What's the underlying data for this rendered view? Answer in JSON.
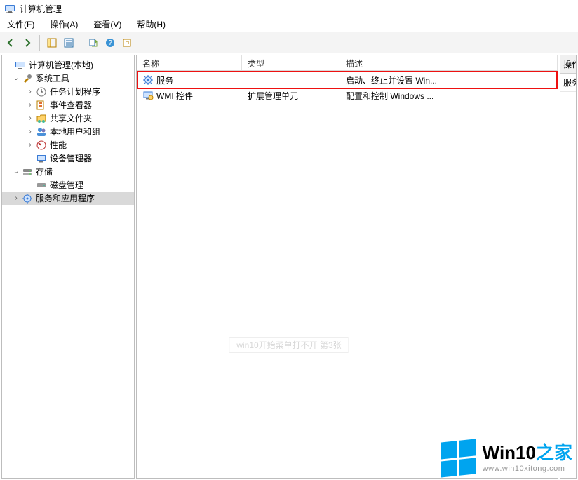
{
  "title": "计算机管理",
  "menus": {
    "file": "文件(F)",
    "action": "操作(A)",
    "view": "查看(V)",
    "help": "帮助(H)"
  },
  "toolbar": {
    "back": "back",
    "forward": "forward",
    "up": "up",
    "properties": "properties",
    "export": "export",
    "refresh": "refresh",
    "help": "help"
  },
  "tree": {
    "root": "计算机管理(本地)",
    "system_tools": "系统工具",
    "task_scheduler": "任务计划程序",
    "event_viewer": "事件查看器",
    "shared_folders": "共享文件夹",
    "local_users": "本地用户和组",
    "performance": "性能",
    "device_manager": "设备管理器",
    "storage": "存储",
    "disk_management": "磁盘管理",
    "services_apps": "服务和应用程序"
  },
  "list": {
    "headers": {
      "name": "名称",
      "type": "类型",
      "desc": "描述"
    },
    "rows": [
      {
        "name": "服务",
        "type": "",
        "desc": "启动、终止并设置 Win..."
      },
      {
        "name": "WMI 控件",
        "type": "扩展管理单元",
        "desc": "配置和控制 Windows ..."
      }
    ]
  },
  "action_pane": {
    "header": "操作",
    "row": "服务"
  },
  "caption": "win10开始菜单打不开 第3张",
  "watermark": {
    "brand_main": "Win10",
    "brand_suffix": "之家",
    "url": "www.win10xitong.com"
  }
}
